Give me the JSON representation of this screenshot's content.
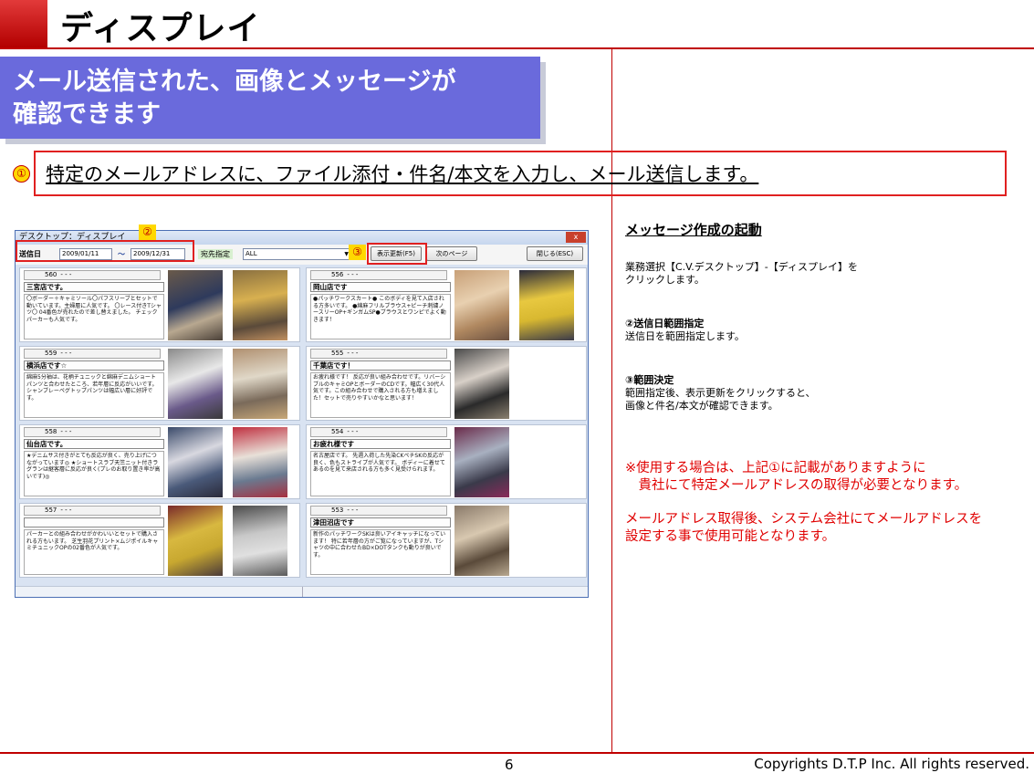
{
  "header": {
    "title": "ディスプレイ"
  },
  "banner": {
    "line1": "メール送信された、画像とメッセージが",
    "line2": "確認できます"
  },
  "step1": {
    "marker": "①",
    "text": "特定のメールアドレスに、ファイル添付・件名/本文を入力し、メール送信します。"
  },
  "markers": {
    "m2": "②",
    "m3": "③"
  },
  "window": {
    "title": "デスクトップ：ディスプレイ",
    "close": "x",
    "toolbar": {
      "send_date_label": "送信日",
      "date_from": "2009/01/11",
      "tilde": "～",
      "date_to": "2009/12/31",
      "dest_label": "宛先指定",
      "dest_value": "ALL",
      "refresh_button": "表示更新(F5)",
      "next_button": "次のページ",
      "close_button": "閉じる(ESC)"
    },
    "cards": [
      {
        "num": "560",
        "store": "三宮店です。",
        "message": "〇ボーダー＋キャミソール〇パフスリーブとセットで動いています。主婦層に人気です。 〇レース付きTシャツ〇 04番色が売れたので差し替えました。 チェックパーカーも人気です。"
      },
      {
        "num": "556",
        "store": "岡山店です",
        "message": "●パッチワークスカート● このボディを見て入店される方多いです。 ●綿麻フリルブラウス+ピーチ刺繍ノースリーOP+ギンガムSP●ブラウスとワンピでよく動きます！"
      },
      {
        "num": "559",
        "store": "横浜店です☆",
        "message": "綿麻5分袖は、花柄チュニックと綿麻デニムショートパンツと合わせたところ、若年層に反応がいいです。 シャンブレーペグトップパンツは幅広い層に好評です。"
      },
      {
        "num": "555",
        "store": "千葉店です！",
        "message": "お疲れ様です！ 反応が良い組み合わせです。リバーシブルのキャミOPとボーダーのCDです。幅広く30代人気です。この組み合わせで購入される方も増えました！セットで売りやすいかなと思います！"
      },
      {
        "num": "558",
        "store": "仙台店です。",
        "message": "★デニムサス付きがとても反応が良く、売り上げにつながっています◎ ★ショートスラブ天竺ニット付きラグランは継客層に反応が良く(プレのお取り置き率が高いです)◎"
      },
      {
        "num": "554",
        "store": "お疲れ様です",
        "message": "名古屋店です。 先週入荷した先染CKペチSKの反応が良く、色もストライプが人気です。 ボディーに着せてあるのを見て来店される方も多く見受けられます。"
      },
      {
        "num": "557",
        "store": "",
        "message": "パーカーとの組み合わせがかわいいとセットで購入される方もいます。 芝生羽花プリント×ムジポイルキャミチュニックOPの02番色が人気です。"
      },
      {
        "num": "553",
        "store": "津田沼店です",
        "message": "新作のパッチワークSKは良いアイキャッチになっています！ 特に若年層の方がご覧になっていますが、Tシャツの中に合わせたBD×DOTタンクも動りが良いです。"
      }
    ]
  },
  "right": {
    "heading": "メッセージ作成の起動",
    "p1_line1": "業務選択【C.V.デスクトップ】-【ディスプレイ】を",
    "p1_line2": "クリックします。",
    "p2_title": "②送信日範囲指定",
    "p2_text": "送信日を範囲指定します。",
    "p3_title": "③範囲決定",
    "p3_line1": "範囲指定後、表示更新をクリックすると、",
    "p3_line2": "画像と件名/本文が確認できます。",
    "note_line1": "※使用する場合は、上記①に記載がありますように",
    "note_line2": "　貴社にて特定メールアドレスの取得が必要となります。",
    "note_line3": "メールアドレス取得後、システム会社にてメールアドレスを",
    "note_line4": "設定する事で使用可能となります。"
  },
  "footer": {
    "page": "6",
    "copyright": "Copyrights  D.T.P Inc. All rights reserved."
  },
  "colors": {
    "accent_red": "#c00000",
    "banner_blue": "#6a6adc",
    "marker_yellow": "#ffd800"
  }
}
